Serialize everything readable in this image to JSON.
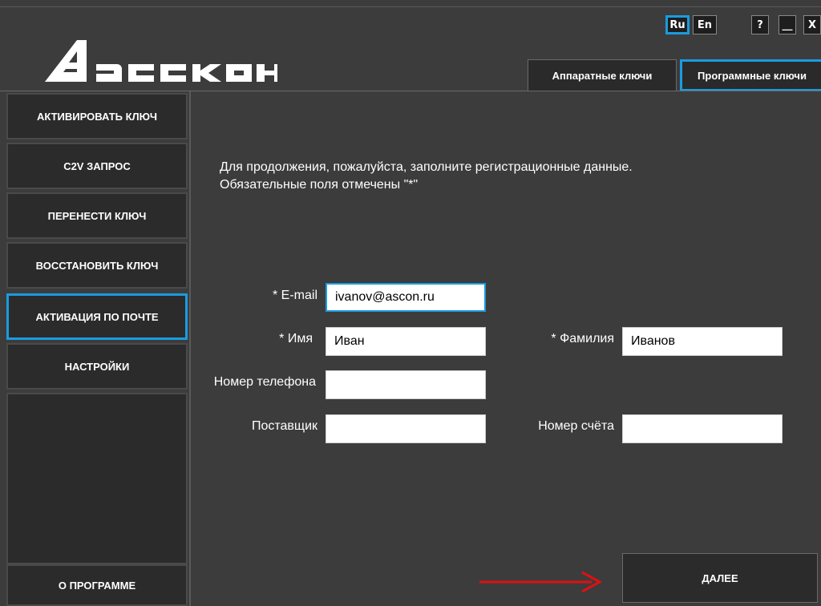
{
  "logo": {
    "text": "АСКОН"
  },
  "languages": [
    {
      "label": "Ru",
      "active": true
    },
    {
      "label": "En",
      "active": false
    }
  ],
  "window_controls": {
    "help": "?",
    "minimize": "__",
    "close": "X"
  },
  "tabs": [
    {
      "label": "Аппаратные ключи",
      "active": false
    },
    {
      "label": "Программные ключи",
      "active": true
    }
  ],
  "sidebar": {
    "items": [
      {
        "label": "АКТИВИРОВАТЬ КЛЮЧ",
        "active": false
      },
      {
        "label": "C2V ЗАПРОС",
        "active": false
      },
      {
        "label": "ПЕРЕНЕСТИ КЛЮЧ",
        "active": false
      },
      {
        "label": "ВОССТАНОВИТЬ КЛЮЧ",
        "active": false
      },
      {
        "label": "АКТИВАЦИЯ ПО ПОЧТЕ",
        "active": true
      },
      {
        "label": "НАСТРОЙКИ",
        "active": false
      }
    ],
    "about": "О ПРОГРАММЕ"
  },
  "main": {
    "intro_line1": "Для продолжения, пожалуйста, заполните регистрационные данные.",
    "intro_line2": "Обязательные поля отмечены \"*\"",
    "fields": {
      "email": {
        "label": "* E-mail",
        "value": "ivanov@ascon.ru"
      },
      "first_name": {
        "label": "* Имя",
        "value": "Иван"
      },
      "last_name": {
        "label": "* Фамилия",
        "value": "Иванов"
      },
      "phone": {
        "label": "Номер телефона",
        "value": ""
      },
      "supplier": {
        "label": "Поставщик",
        "value": ""
      },
      "invoice": {
        "label": "Номер счёта",
        "value": ""
      }
    },
    "next_button": "ДАЛЕЕ"
  },
  "colors": {
    "accent": "#1a9be0",
    "arrow": "#e01010",
    "background": "#3c3c3c"
  }
}
